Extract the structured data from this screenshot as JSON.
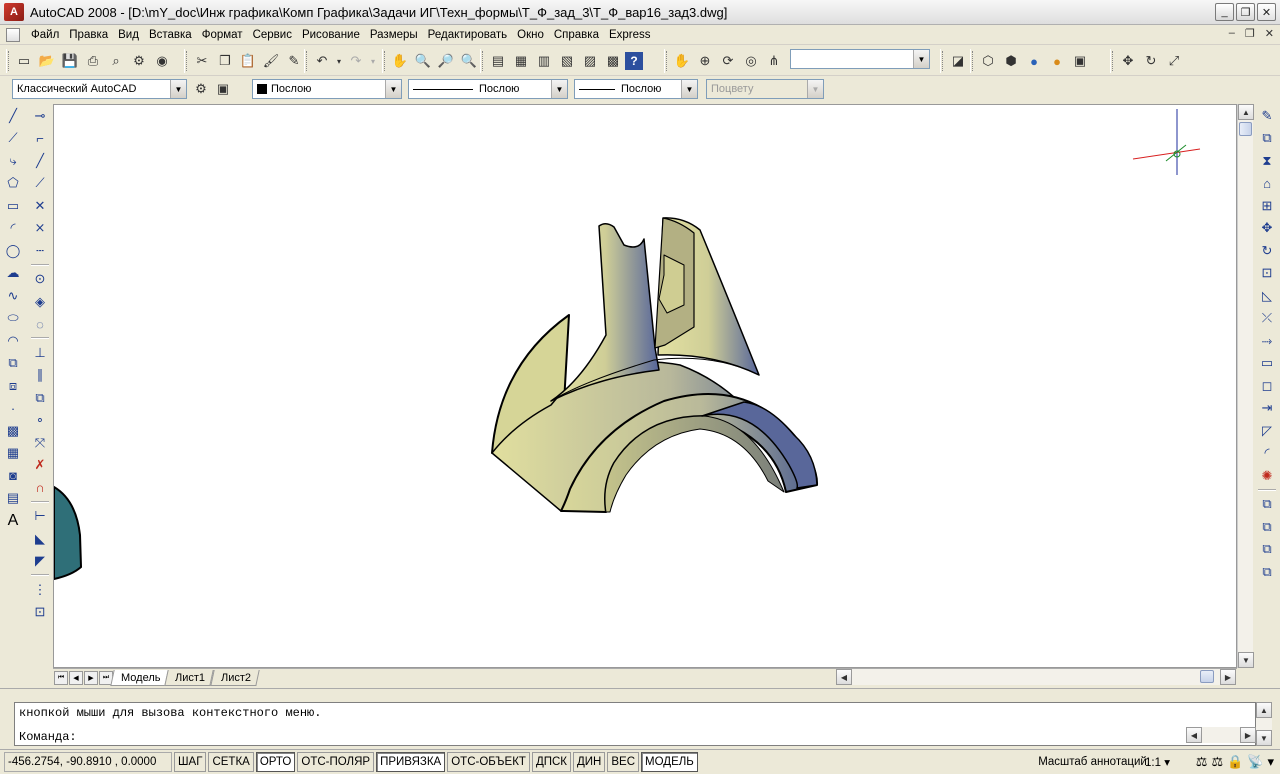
{
  "window": {
    "title": "AutoCAD 2008 - [D:\\mY_doc\\Инж графика\\Комп Графика\\Задачи ИГ\\Техн_формы\\Т_Ф_зад_3\\Т_Ф_вар16_зад3.dwg]",
    "app_icon_text": "A",
    "controls": [
      "_",
      "❐",
      "✕"
    ]
  },
  "menubar": {
    "items": [
      "Файл",
      "Правка",
      "Вид",
      "Вставка",
      "Формат",
      "Сервис",
      "Рисование",
      "Размеры",
      "Редактировать",
      "Окно",
      "Справка",
      "Express"
    ],
    "doc_controls": [
      "–",
      "❐",
      "✕"
    ]
  },
  "toolbar": {
    "workspace": "Классический AutoCAD",
    "color": "Послою",
    "linetype": "Послою",
    "lineweight": "Послою",
    "plotstyle": "Поцвету",
    "named_view": ""
  },
  "tabs": {
    "items": [
      "Модель",
      "Лист1",
      "Лист2"
    ],
    "active": "Модель"
  },
  "command": {
    "history_line": "кнопкой мыши для вызова контекстного меню.",
    "prompt": "Команда:"
  },
  "status": {
    "coords": "-456.2754, -90.8910 , 0.0000",
    "toggles": [
      {
        "label": "ШАГ",
        "on": false
      },
      {
        "label": "СЕТКА",
        "on": false
      },
      {
        "label": "ОРТО",
        "on": true
      },
      {
        "label": "ОТС-ПОЛЯР",
        "on": false
      },
      {
        "label": "ПРИВЯЗКА",
        "on": true
      },
      {
        "label": "ОТС-ОБЪЕКТ",
        "on": false
      },
      {
        "label": "ДПСК",
        "on": false
      },
      {
        "label": "ДИН",
        "on": false
      },
      {
        "label": "ВЕС",
        "on": false
      },
      {
        "label": "МОДЕЛЬ",
        "on": true
      }
    ],
    "annotation_scale_label": "Масштаб аннотаций:",
    "annotation_scale_value": "1:1"
  },
  "colors": {
    "model_light": "#d8d79a",
    "model_dark": "#4c5e8f",
    "ucs_x": "#d81e1e",
    "ucs_y": "#1c2e9e",
    "teal_object": "#2f6f78"
  }
}
